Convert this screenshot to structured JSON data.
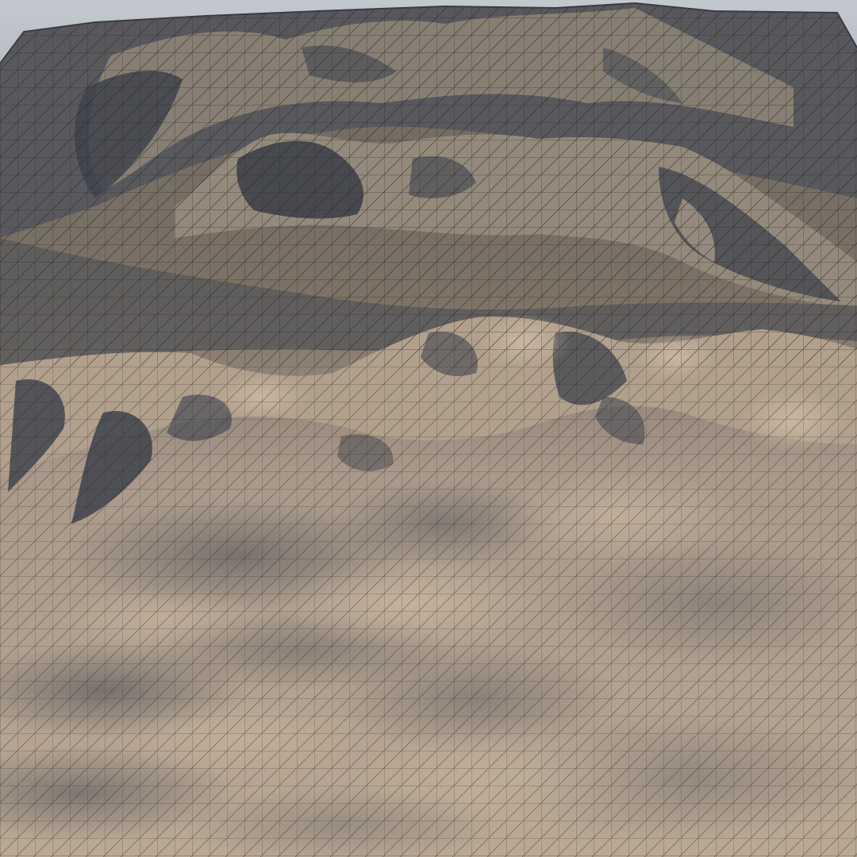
{
  "scene": {
    "subject": "wireframe-terrain-render",
    "colors": {
      "sky_top": "#c3c8ce",
      "sky_bottom": "#b4b9bf",
      "terrain_light": "#c3b19b",
      "terrain_mid": "#9a8b7a",
      "terrain_shadow": "#4a4d55",
      "ridge_dark": "#3c3f48",
      "wire": "#2b2622"
    }
  }
}
